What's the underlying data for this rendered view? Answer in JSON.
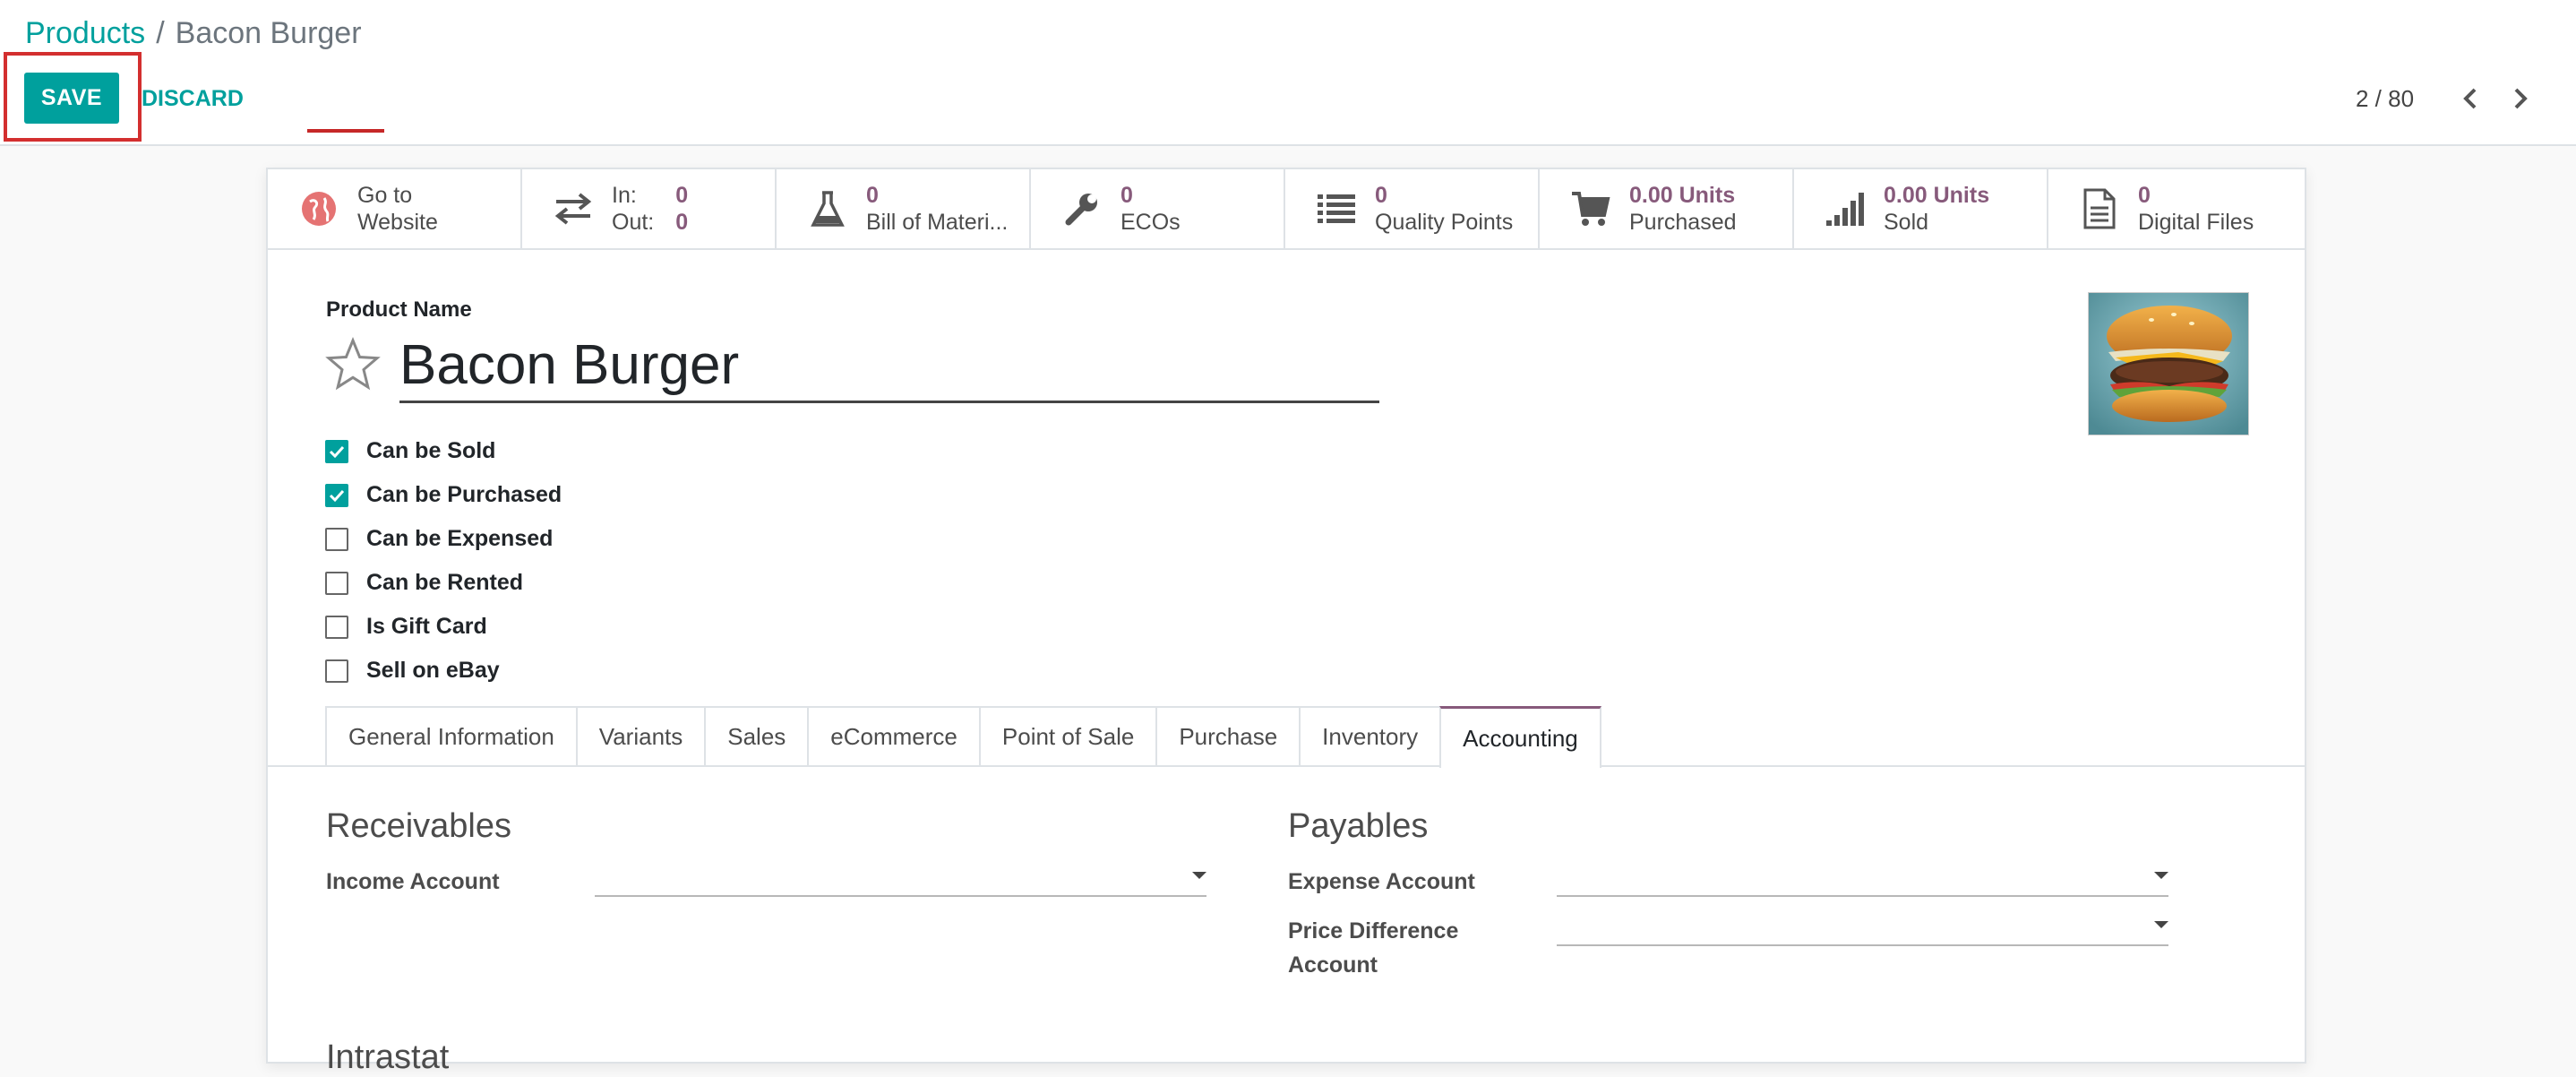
{
  "breadcrumb": {
    "parent": "Products",
    "separator": "/",
    "current": "Bacon Burger"
  },
  "toolbar": {
    "save_label": "SAVE",
    "discard_label": "DISCARD"
  },
  "pager": {
    "value": "2 / 80"
  },
  "smart_buttons": [
    {
      "icon": "globe-icon",
      "line1": "Go to",
      "line2": "Website"
    },
    {
      "icon": "arrows-exchange-icon",
      "in_label": "In:",
      "in_value": "0",
      "out_label": "Out:",
      "out_value": "0"
    },
    {
      "icon": "flask-icon",
      "value": "0",
      "label": "Bill of Materi..."
    },
    {
      "icon": "wrench-icon",
      "value": "0",
      "label": "ECOs"
    },
    {
      "icon": "list-icon",
      "value": "0",
      "label": "Quality Points"
    },
    {
      "icon": "shopping-cart-icon",
      "value": "0.00 Units",
      "label": "Purchased"
    },
    {
      "icon": "signal-bars-icon",
      "value": "0.00 Units",
      "label": "Sold"
    },
    {
      "icon": "file-icon",
      "value": "0",
      "label": "Digital Files"
    }
  ],
  "product": {
    "name_label": "Product Name",
    "name": "Bacon Burger"
  },
  "options": [
    {
      "label": "Can be Sold",
      "checked": true
    },
    {
      "label": "Can be Purchased",
      "checked": true
    },
    {
      "label": "Can be Expensed",
      "checked": false
    },
    {
      "label": "Can be Rented",
      "checked": false
    },
    {
      "label": "Is Gift Card",
      "checked": false
    },
    {
      "label": "Sell on eBay",
      "checked": false
    }
  ],
  "tabs": [
    {
      "label": "General Information",
      "active": false
    },
    {
      "label": "Variants",
      "active": false
    },
    {
      "label": "Sales",
      "active": false
    },
    {
      "label": "eCommerce",
      "active": false
    },
    {
      "label": "Point of Sale",
      "active": false
    },
    {
      "label": "Purchase",
      "active": false
    },
    {
      "label": "Inventory",
      "active": false
    },
    {
      "label": "Accounting",
      "active": true
    }
  ],
  "accounting": {
    "receivables_title": "Receivables",
    "income_account_label": "Income Account",
    "income_account_value": "",
    "payables_title": "Payables",
    "expense_account_label": "Expense Account",
    "expense_account_value": "",
    "price_diff_label_1": "Price Difference",
    "price_diff_label_2": "Account",
    "price_diff_value": "",
    "next_section_partial": "Intrastat"
  },
  "colors": {
    "primary": "#00A09D",
    "accent": "#875A7B",
    "highlight": "#d32f2f"
  }
}
